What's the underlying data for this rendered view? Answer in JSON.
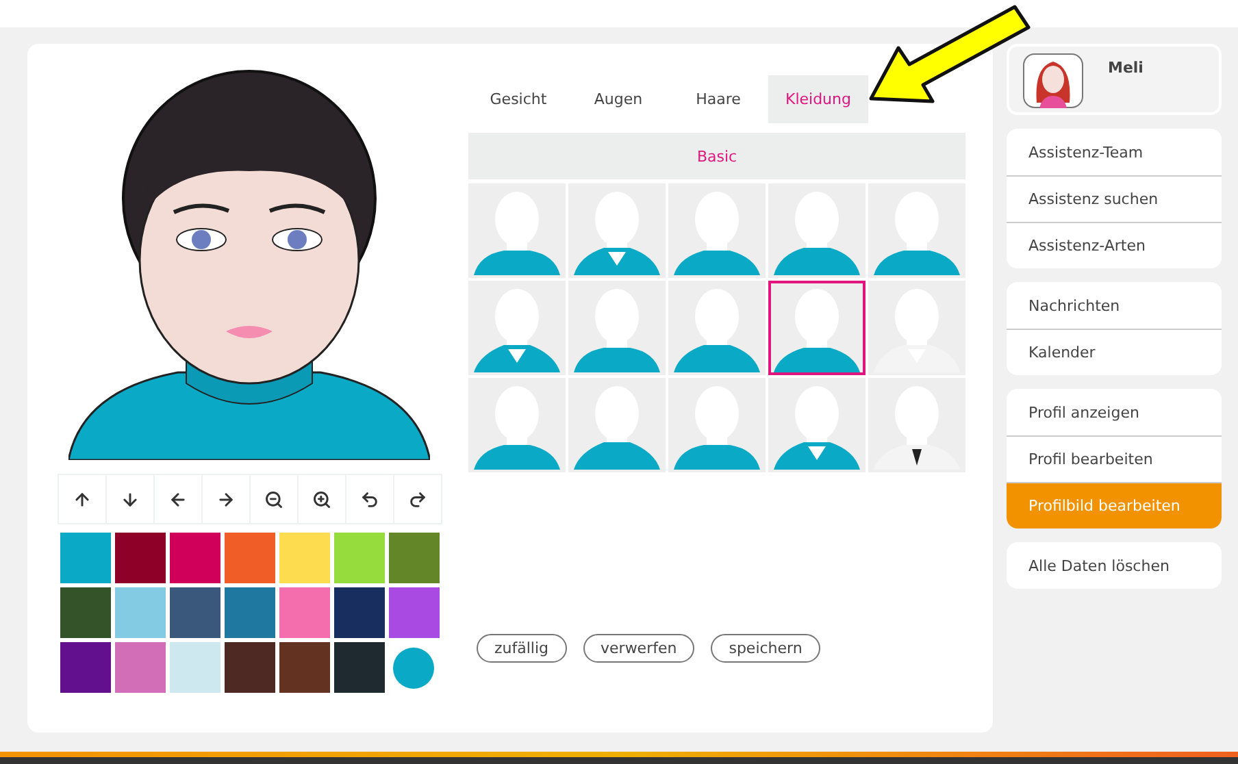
{
  "tabs": [
    {
      "label": "Gesicht",
      "selected": false
    },
    {
      "label": "Augen",
      "selected": false
    },
    {
      "label": "Haare",
      "selected": false
    },
    {
      "label": "Kleidung",
      "selected": true
    }
  ],
  "category": {
    "label": "Basic"
  },
  "clothing_options": [
    {
      "selected": false
    },
    {
      "selected": false
    },
    {
      "selected": false
    },
    {
      "selected": false
    },
    {
      "selected": false
    },
    {
      "selected": false
    },
    {
      "selected": false
    },
    {
      "selected": false
    },
    {
      "selected": true
    },
    {
      "selected": false
    },
    {
      "selected": false
    },
    {
      "selected": false
    },
    {
      "selected": false
    },
    {
      "selected": false
    },
    {
      "selected": false
    }
  ],
  "swatches": [
    {
      "color": "#0aa9c6"
    },
    {
      "color": "#8e0028"
    },
    {
      "color": "#d0005a"
    },
    {
      "color": "#f05d26"
    },
    {
      "color": "#fddc4f"
    },
    {
      "color": "#96dc3c"
    },
    {
      "color": "#628628"
    },
    {
      "color": "#345329"
    },
    {
      "color": "#83cbe3"
    },
    {
      "color": "#3a577c"
    },
    {
      "color": "#1f78a0"
    },
    {
      "color": "#f46eae"
    },
    {
      "color": "#172e5e"
    },
    {
      "color": "#a94be3"
    },
    {
      "color": "#62108e"
    },
    {
      "color": "#d26db8"
    },
    {
      "color": "#cde8ef"
    },
    {
      "color": "#4e2822"
    },
    {
      "color": "#633220"
    },
    {
      "color": "#1f2930"
    }
  ],
  "current_color": {
    "color": "#0aa9c6"
  },
  "actions": [
    "zufällig",
    "verwerfen",
    "speichern"
  ],
  "profile": {
    "name": "Meli"
  },
  "menu_groups": [
    [
      {
        "label": "Assistenz-Team",
        "selected": false
      },
      {
        "label": "Assistenz suchen",
        "selected": false
      },
      {
        "label": "Assistenz-Arten",
        "selected": false
      }
    ],
    [
      {
        "label": "Nachrichten",
        "selected": false
      },
      {
        "label": "Kalender",
        "selected": false
      }
    ],
    [
      {
        "label": "Profil anzeigen",
        "selected": false
      },
      {
        "label": "Profil bearbeiten",
        "selected": false
      },
      {
        "label": "Profilbild bearbeiten",
        "selected": true
      }
    ],
    [
      {
        "label": "Alle Daten löschen",
        "selected": false
      }
    ]
  ]
}
